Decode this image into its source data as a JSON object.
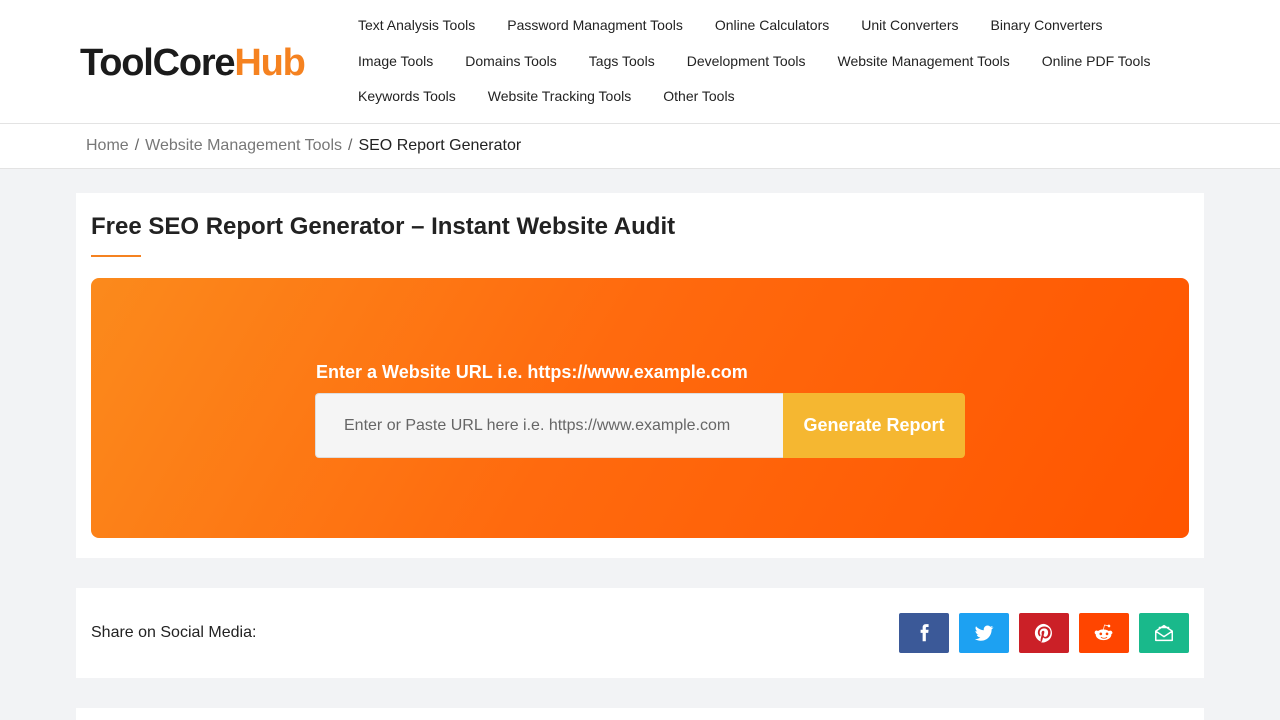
{
  "logo": {
    "part1": "ToolCore",
    "part2": "Hub"
  },
  "nav": {
    "row1": [
      "Text Analysis Tools",
      "Password Managment Tools",
      "Online Calculators",
      "Unit Converters",
      "Binary Converters"
    ],
    "row2": [
      "Image Tools",
      "Domains Tools",
      "Tags Tools",
      "Development Tools",
      "Website Management Tools",
      "Online PDF Tools"
    ],
    "row3": [
      "Keywords Tools",
      "Website Tracking Tools",
      "Other Tools"
    ]
  },
  "breadcrumb": {
    "home": "Home",
    "category": "Website Management Tools",
    "current": "SEO Report Generator",
    "separator": "/"
  },
  "page": {
    "title": "Free SEO Report Generator – Instant Website Audit"
  },
  "hero": {
    "label": "Enter a Website URL i.e. https://www.example.com",
    "input_placeholder": "Enter or Paste URL here i.e. https://www.example.com",
    "input_value": "",
    "button_label": "Generate Report"
  },
  "share": {
    "label": "Share on Social Media:",
    "buttons": [
      {
        "name": "facebook",
        "icon": "facebook-icon",
        "color": "#3b5998"
      },
      {
        "name": "twitter",
        "icon": "twitter-icon",
        "color": "#1da1f2"
      },
      {
        "name": "pinterest",
        "icon": "pinterest-icon",
        "color": "#cb2027"
      },
      {
        "name": "reddit",
        "icon": "reddit-icon",
        "color": "#ff4500"
      },
      {
        "name": "email",
        "icon": "email-icon",
        "color": "#19b98b"
      }
    ]
  },
  "colors": {
    "brand": "#f58220",
    "hero_gradient_start": "#fb8a1c",
    "hero_gradient_end": "#ff5500",
    "button": "#f5b731"
  }
}
